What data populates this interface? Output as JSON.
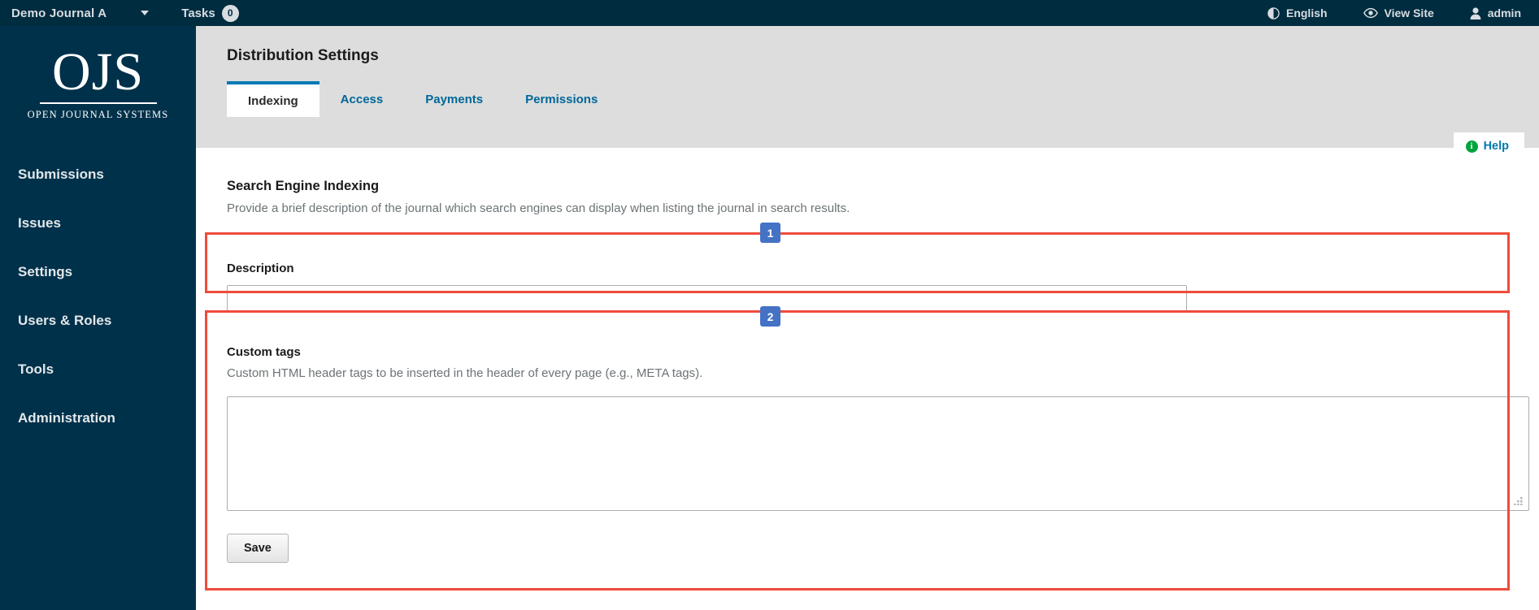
{
  "topbar": {
    "journal_name": "Demo Journal A",
    "journal_caret_icon": "chevron-down-icon",
    "tasks_label": "Tasks",
    "tasks_count": "0",
    "right_items": [
      {
        "label": "English",
        "icon": "globe-icon"
      },
      {
        "label": "View Site",
        "icon": "eye-icon"
      },
      {
        "label": "admin",
        "icon": "user-icon"
      }
    ]
  },
  "sidebar": {
    "logo_text": "OJS",
    "logo_subtitle": "OPEN JOURNAL SYSTEMS",
    "items": [
      {
        "label": "Submissions"
      },
      {
        "label": "Issues"
      },
      {
        "label": "Settings"
      },
      {
        "label": "Users & Roles"
      },
      {
        "label": "Tools"
      },
      {
        "label": "Administration"
      }
    ]
  },
  "main": {
    "page_title": "Distribution Settings",
    "tabs": [
      {
        "label": "Indexing",
        "active": true
      },
      {
        "label": "Access",
        "active": false
      },
      {
        "label": "Payments",
        "active": false
      },
      {
        "label": "Permissions",
        "active": false
      }
    ],
    "help_label": "Help",
    "help_icon": "info-icon",
    "section": {
      "heading": "Search Engine Indexing",
      "description": "Provide a brief description of the journal which search engines can display when listing the journal in search results."
    },
    "description_field": {
      "label": "Description",
      "value": "",
      "placeholder": ""
    },
    "custom_tags_field": {
      "label": "Custom tags",
      "description": "Custom HTML header tags to be inserted in the header of every page (e.g., META tags).",
      "value": "",
      "placeholder": "",
      "resize_handle_icon": "resize-grip-icon"
    },
    "save_label": "Save"
  },
  "annotations": [
    {
      "number": "1",
      "target": "description-field-group"
    },
    {
      "number": "2",
      "target": "custom-tags-field-group"
    }
  ],
  "colors": {
    "topbar_bg": "#002C40",
    "sidebar_bg": "#00314A",
    "main_bg": "#DDDDDD",
    "panel_bg": "#FFFFFF",
    "link_blue": "#006798",
    "active_tab_border": "#007AB2",
    "annotation_red": "#EE4B3C",
    "annotation_badge_blue": "#4472C4",
    "help_icon_green": "#00A43C"
  }
}
